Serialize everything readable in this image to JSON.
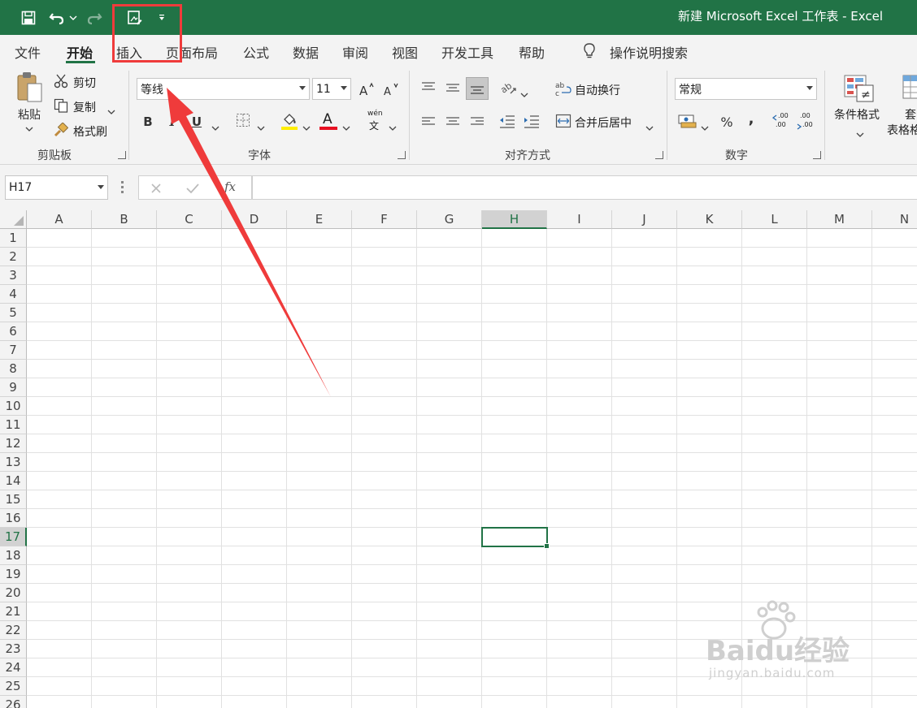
{
  "window": {
    "title": "新建 Microsoft Excel 工作表  -  Excel",
    "accent_color": "#217346"
  },
  "qat": {
    "save_icon": "save-icon",
    "undo_icon": "undo-icon",
    "redo_icon": "redo-icon",
    "print_preview_icon": "print-preview-icon",
    "customize_icon": "customize-qat-icon"
  },
  "tabs": [
    {
      "label": "文件"
    },
    {
      "label": "开始"
    },
    {
      "label": "插入"
    },
    {
      "label": "页面布局"
    },
    {
      "label": "公式"
    },
    {
      "label": "数据"
    },
    {
      "label": "审阅"
    },
    {
      "label": "视图"
    },
    {
      "label": "开发工具"
    },
    {
      "label": "帮助"
    }
  ],
  "tell_me": {
    "label": "操作说明搜索",
    "icon": "lightbulb-icon"
  },
  "ribbon": {
    "clipboard": {
      "group_label": "剪贴板",
      "paste": "粘贴",
      "cut": "剪切",
      "copy": "复制",
      "format_painter": "格式刷"
    },
    "font": {
      "group_label": "字体",
      "font_name": "等线",
      "font_size": "11",
      "bold": "B",
      "italic": "I",
      "underline": "U",
      "font_color_letter": "A",
      "phonetic_top": "wén",
      "phonetic_bottom": "文"
    },
    "alignment": {
      "group_label": "对齐方式",
      "wrap_text": "自动换行",
      "merge_center": "合并后居中"
    },
    "number": {
      "group_label": "数字",
      "format": "常规",
      "percent": "%",
      "comma": ",",
      "increase_decimal": ".00",
      "decrease_decimal": ".00"
    },
    "styles": {
      "conditional_formatting": "条件格式",
      "format_as_table_top": "套",
      "format_as_table": "表格格"
    }
  },
  "formula_bar": {
    "name_box": "H17",
    "fx": "fx",
    "value": ""
  },
  "sheet": {
    "columns": [
      "A",
      "B",
      "C",
      "D",
      "E",
      "F",
      "G",
      "H",
      "I",
      "J",
      "K",
      "L",
      "M",
      "N"
    ],
    "rows": [
      "1",
      "2",
      "3",
      "4",
      "5",
      "6",
      "7",
      "8",
      "9",
      "10",
      "11",
      "12",
      "13",
      "14",
      "15",
      "16",
      "17",
      "18",
      "19",
      "20",
      "21",
      "22",
      "23",
      "24",
      "25",
      "26"
    ],
    "selected_column": "H",
    "selected_row": "17"
  },
  "annotation": {
    "highlight_color": "#ef3b3b"
  },
  "watermark": {
    "brand": "Baidu经验",
    "url": "jingyan.baidu.com"
  }
}
